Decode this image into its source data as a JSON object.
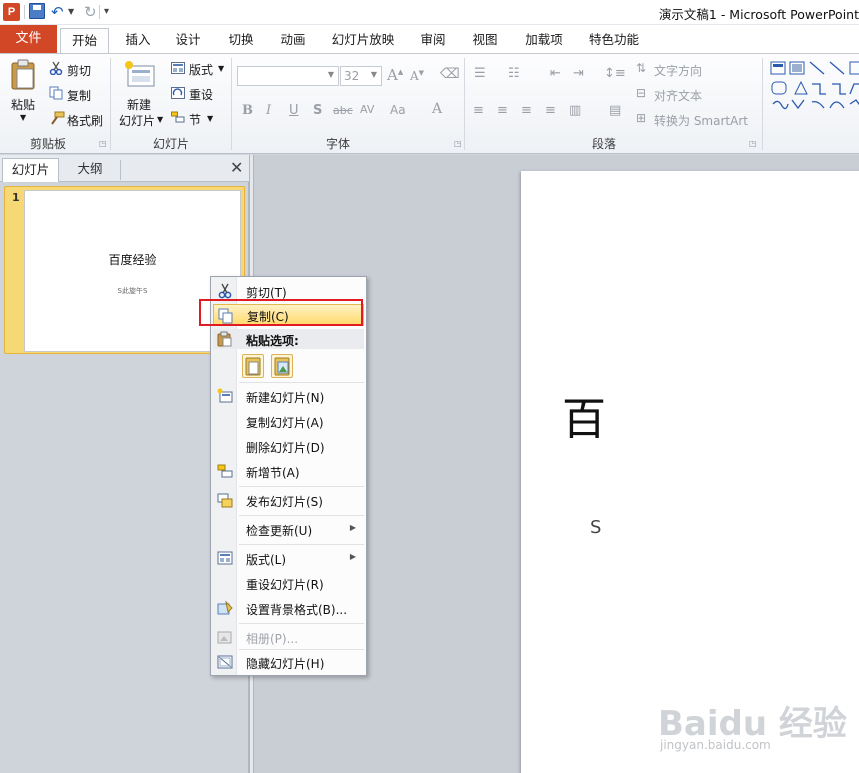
{
  "window": {
    "title": "演示文稿1 - Microsoft PowerPoint",
    "app_logo": "P"
  },
  "ribbon": {
    "tabs": [
      {
        "label": "文件"
      },
      {
        "label": "开始"
      },
      {
        "label": "插入"
      },
      {
        "label": "设计"
      },
      {
        "label": "切换"
      },
      {
        "label": "动画"
      },
      {
        "label": "幻灯片放映"
      },
      {
        "label": "审阅"
      },
      {
        "label": "视图"
      },
      {
        "label": "加载项"
      },
      {
        "label": "特色功能"
      }
    ],
    "clipboard": {
      "paste": "粘贴",
      "cut": "剪切",
      "copy": "复制",
      "format_painter": "格式刷",
      "group": "剪贴板"
    },
    "slides": {
      "new_slide_1": "新建",
      "new_slide_2": "幻灯片",
      "layout": "版式",
      "reset": "重设",
      "section": "节",
      "group": "幻灯片"
    },
    "font": {
      "size": "32",
      "group": "字体"
    },
    "paragraph": {
      "text_direction": "文字方向",
      "align_text": "对齐文本",
      "smartart": "转换为 SmartArt",
      "group": "段落"
    }
  },
  "panel": {
    "tab_slides": "幻灯片",
    "tab_outline": "大纲",
    "slide_number": "1",
    "thumb_title": "百度经验",
    "thumb_subtitle": "S此旋午S"
  },
  "canvas": {
    "title_partial": "百",
    "subtitle_partial": "S"
  },
  "context_menu": {
    "cut": "剪切(T)",
    "copy": "复制(C)",
    "paste_options": "粘贴选项:",
    "new_slide": "新建幻灯片(N)",
    "duplicate_slide": "复制幻灯片(A)",
    "delete_slide": "删除幻灯片(D)",
    "add_section": "新增节(A)",
    "publish_slides": "发布幻灯片(S)",
    "check_updates": "检查更新(U)",
    "layout": "版式(L)",
    "reset_slide": "重设幻灯片(R)",
    "format_background": "设置背景格式(B)...",
    "photo_album": "相册(P)...",
    "hide_slide": "隐藏幻灯片(H)"
  },
  "watermark": {
    "text": "Baidu 经验",
    "url": "jingyan.baidu.com"
  },
  "colors": {
    "file_tab": "#d24726",
    "menu_highlight": "#ffd96b",
    "annotation_box": "#e01b22"
  }
}
